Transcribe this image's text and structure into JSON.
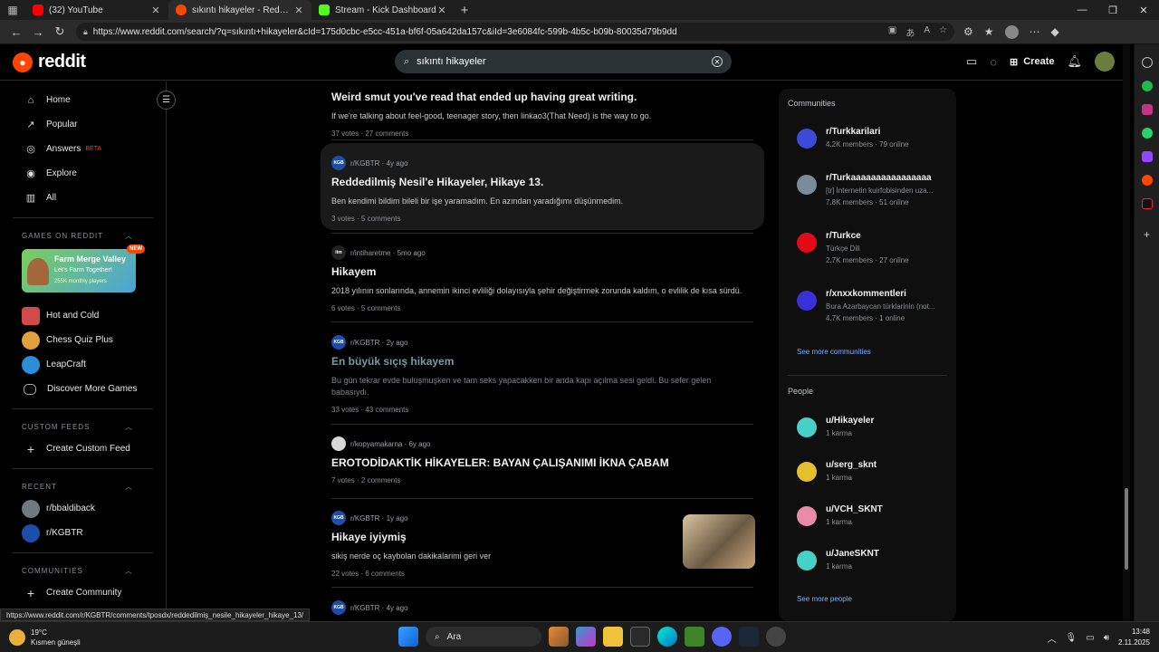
{
  "browser": {
    "tabs": [
      {
        "title": "(32) YouTube",
        "color": "#ff0000",
        "active": false
      },
      {
        "title": "sıkıntı hikayeler - Reddit Search!",
        "color": "#ff4500",
        "active": true
      },
      {
        "title": "Stream - Kick Dashboard",
        "color": "#53fc18",
        "active": false
      }
    ],
    "url": "https://www.reddit.com/search/?q=sıkıntı+hikayeler&cId=175d0cbc-e5cc-451a-bf6f-05a642da157c&iId=3e6084fc-599b-4b5c-b09b-80035d79b9dd",
    "status_url": "https://www.reddit.com/r/KGBTR/comments/tposdx/reddedilmiş_nesile_hikayeler_hikaye_13/"
  },
  "header": {
    "logo": "reddit",
    "search_value": "sıkıntı hikayeler",
    "create_label": "Create"
  },
  "sidebar": {
    "nav": [
      {
        "label": "Home",
        "icon": "home-icon",
        "glyph": "⌂"
      },
      {
        "label": "Popular",
        "icon": "popular-icon",
        "glyph": "↗"
      },
      {
        "label": "Answers",
        "icon": "answers-icon",
        "glyph": "◎",
        "badge": "BETA"
      },
      {
        "label": "Explore",
        "icon": "explore-icon",
        "glyph": "◉"
      },
      {
        "label": "All",
        "icon": "all-icon",
        "glyph": "▥"
      }
    ],
    "games_heading": "GAMES ON REDDIT",
    "game_banner": {
      "title": "Farm Merge Valley",
      "subtitle": "Let's Farm Together!",
      "players": "255K monthly players",
      "badge": "NEW"
    },
    "games": [
      {
        "label": "Hot and Cold",
        "color": "#d24b4b"
      },
      {
        "label": "Chess Quiz Plus",
        "color": "#e0a03a"
      },
      {
        "label": "LeapCraft",
        "color": "#2a8fd8"
      },
      {
        "label": "Discover More Games",
        "color": "#333333"
      }
    ],
    "custom_feeds_heading": "CUSTOM FEEDS",
    "create_custom_feed": "Create Custom Feed",
    "recent_heading": "RECENT",
    "recent": [
      {
        "label": "r/bbaldiback",
        "color": "#6f7a80"
      },
      {
        "label": "r/KGBTR",
        "color": "#1d4fa8"
      }
    ],
    "communities_heading": "COMMUNITIES",
    "create_community": "Create Community"
  },
  "posts": [
    {
      "sub": "",
      "age": "",
      "title": "Weird smut you've read that ended up having great writing.",
      "snippet": "If we're talking about feel-good, teenager story, then linkao3(That Need) is the way to go.",
      "votes": "37 votes",
      "comments": "27 comments"
    },
    {
      "sub": "r/KGBTR",
      "age": "4y ago",
      "title": "Reddedilmiş Nesil'e Hikayeler, Hikaye 13.",
      "snippet": "Ben kendimi bildim bileli bir işe yaramadım. En azından yaradığımı düşünmedim.",
      "votes": "3 votes",
      "comments": "5 comments",
      "icon_color": "#1d4fa8",
      "icon_text": "KGB"
    },
    {
      "sub": "r/intiharetme",
      "age": "5mo ago",
      "title": "Hikayem",
      "snippet": "2018 yılının sonlarında, annemin ikinci evliliği dolayısıyla şehir değiştirmek zorunda kaldım, o evlilik de kısa sürdü.",
      "votes": "6 votes",
      "comments": "5 comments",
      "icon_color": "#222222",
      "icon_text": "itm"
    },
    {
      "sub": "r/KGBTR",
      "age": "2y ago",
      "title": "En büyük sıçış hikayem",
      "snippet": "Bu gün tekrar evde buluşmuşken ve tam seks yapacakken bir anda kapı açılma sesi geldi. Bu sefer gelen babasıydı.",
      "votes": "33 votes",
      "comments": "43 comments",
      "icon_color": "#1d4fa8",
      "icon_text": "KGB"
    },
    {
      "sub": "r/kopyamakarna",
      "age": "6y ago",
      "title": "EROTODİDAKTİK HİKAYELER: BAYAN ÇALIŞANIMI İKNA ÇABAM",
      "snippet": "",
      "votes": "7 votes",
      "comments": "2 comments",
      "icon_color": "#d8d8d8",
      "icon_text": ""
    },
    {
      "sub": "r/KGBTR",
      "age": "1y ago",
      "title": "Hikaye iyiymiş",
      "snippet": "sikiş nerde oç kaybolan dakikalarimi geri ver",
      "votes": "22 votes",
      "comments": "6 comments",
      "icon_color": "#1d4fa8",
      "icon_text": "KGB"
    },
    {
      "sub": "r/KGBTR",
      "age": "4y ago",
      "title": "",
      "snippet": "",
      "votes": "",
      "comments": "",
      "icon_color": "#1d4fa8",
      "icon_text": "KGB"
    }
  ],
  "right": {
    "communities_heading": "Communities",
    "communities": [
      {
        "name": "r/Turkkarilari",
        "desc": "",
        "members": "4.2K members",
        "online": "79 online",
        "color": "#3b4bd8"
      },
      {
        "name": "r/Turkaaaaaaaaaaaaaaaa",
        "desc": "[tr] İnternetin kuirfobisinden uza...",
        "members": "7.8K members",
        "online": "51 online",
        "color": "#7a8b9a"
      },
      {
        "name": "r/Turkce",
        "desc": "Türkçe Dili",
        "members": "2.7K members",
        "online": "27 online",
        "color": "#e30a17"
      },
      {
        "name": "r/xnxxkommentleri",
        "desc": "Bura Azarbaycan türklarinin (not...",
        "members": "4.7K members",
        "online": "1 online",
        "color": "#3b2fd8"
      }
    ],
    "see_more_communities": "See more communities",
    "people_heading": "People",
    "people": [
      {
        "name": "u/Hikayeler",
        "karma": "1 karma",
        "color": "#46d0c8"
      },
      {
        "name": "u/serg_sknt",
        "karma": "1 karma",
        "color": "#e6c02a"
      },
      {
        "name": "u/VCH_SKNT",
        "karma": "1 karma",
        "color": "#e88aa8"
      },
      {
        "name": "u/JaneSKNT",
        "karma": "1 karma",
        "color": "#46d0c8"
      }
    ],
    "see_more_people": "See more people"
  },
  "taskbar": {
    "temp": "19°C",
    "weather": "Kısmen güneşli",
    "search_placeholder": "Ara",
    "time": "13:48",
    "date": "2.11.2025"
  }
}
